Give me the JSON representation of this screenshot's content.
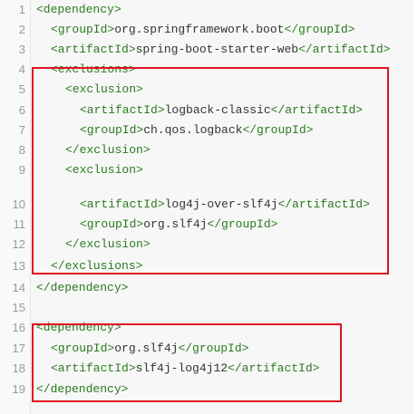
{
  "lines": [
    {
      "n": "1",
      "indent": 0,
      "parts": [
        [
          "t",
          "<dependency>"
        ]
      ]
    },
    {
      "n": "2",
      "indent": 1,
      "parts": [
        [
          "t",
          "<groupId>"
        ],
        [
          "x",
          "org.springframework.boot"
        ],
        [
          "t",
          "</groupId>"
        ]
      ]
    },
    {
      "n": "3",
      "indent": 1,
      "parts": [
        [
          "t",
          "<artifactId>"
        ],
        [
          "x",
          "spring-boot-starter-web"
        ],
        [
          "t",
          "</artifactId>"
        ]
      ]
    },
    {
      "n": "4",
      "indent": 1,
      "parts": [
        [
          "t",
          "<exclusions>"
        ]
      ]
    },
    {
      "n": "5",
      "indent": 2,
      "parts": [
        [
          "t",
          "<exclusion>"
        ]
      ]
    },
    {
      "n": "6",
      "indent": 3,
      "parts": [
        [
          "t",
          "<artifactId>"
        ],
        [
          "x",
          "logback-classic"
        ],
        [
          "t",
          "</artifactId>"
        ]
      ]
    },
    {
      "n": "7",
      "indent": 3,
      "parts": [
        [
          "t",
          "<groupId>"
        ],
        [
          "x",
          "ch.qos.logback"
        ],
        [
          "t",
          "</groupId>"
        ]
      ]
    },
    {
      "n": "8",
      "indent": 2,
      "parts": [
        [
          "t",
          "</exclusion>"
        ]
      ]
    },
    {
      "n": "9",
      "indent": 2,
      "parts": [
        [
          "t",
          "<exclusion>"
        ]
      ]
    },
    {
      "n": "10",
      "indent": 3,
      "parts": [
        [
          "t",
          "<artifactId>"
        ],
        [
          "x",
          "log4j-over-slf4j"
        ],
        [
          "t",
          "</artifactId>"
        ]
      ]
    },
    {
      "n": "11",
      "indent": 3,
      "parts": [
        [
          "t",
          "<groupId>"
        ],
        [
          "x",
          "org.slf4j"
        ],
        [
          "t",
          "</groupId>"
        ]
      ]
    },
    {
      "n": "12",
      "indent": 2,
      "parts": [
        [
          "t",
          "</exclusion>"
        ]
      ]
    },
    {
      "n": "13",
      "indent": 1,
      "parts": [
        [
          "t",
          "</exclusions>"
        ]
      ]
    },
    {
      "n": "14",
      "indent": 0,
      "parts": [
        [
          "t",
          "</dependency>"
        ]
      ]
    },
    {
      "n": "15",
      "indent": 0,
      "parts": []
    },
    {
      "n": "16",
      "indent": 0,
      "parts": [
        [
          "t",
          "<dependency>"
        ]
      ]
    },
    {
      "n": "17",
      "indent": 1,
      "parts": [
        [
          "t",
          "<groupId>"
        ],
        [
          "x",
          "org.slf4j"
        ],
        [
          "t",
          "</groupId>"
        ]
      ]
    },
    {
      "n": "18",
      "indent": 1,
      "parts": [
        [
          "t",
          "<artifactId>"
        ],
        [
          "x",
          "slf4j-log4j12"
        ],
        [
          "t",
          "</artifactId>"
        ]
      ]
    },
    {
      "n": "19",
      "indent": 0,
      "parts": [
        [
          "t",
          "</dependency>"
        ]
      ]
    }
  ],
  "colors": {
    "tag": "#2a7a1e",
    "text": "#333333",
    "highlight": "#e0141e"
  }
}
